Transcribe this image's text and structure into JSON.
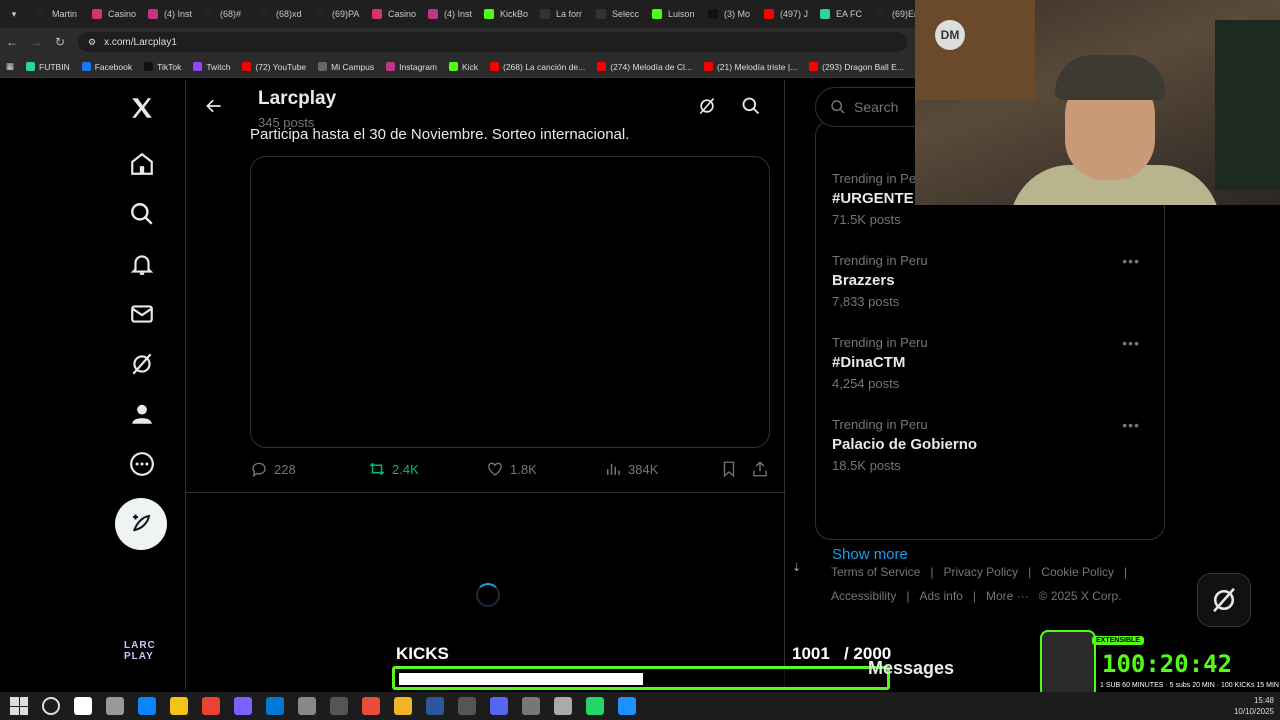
{
  "browser": {
    "tabs": [
      {
        "label": "Martin",
        "color": "#222"
      },
      {
        "label": "Casino",
        "color": "#d6336c"
      },
      {
        "label": "(4) Inst",
        "color": "#c13584"
      },
      {
        "label": "(68)#",
        "color": "#222"
      },
      {
        "label": "(68)xd",
        "color": "#222"
      },
      {
        "label": "(69)PA",
        "color": "#222"
      },
      {
        "label": "Casino",
        "color": "#d6336c"
      },
      {
        "label": "(4) Inst",
        "color": "#c13584"
      },
      {
        "label": "KickBo",
        "color": "#53fc18"
      },
      {
        "label": "La forr",
        "color": "#333"
      },
      {
        "label": "Selecc",
        "color": "#333"
      },
      {
        "label": "Luison",
        "color": "#53fc18"
      },
      {
        "label": "(3) Mo",
        "color": "#111"
      },
      {
        "label": "(497) J",
        "color": "#ff0000"
      },
      {
        "label": "EA FC",
        "color": "#2bd4a0"
      },
      {
        "label": "(69)Enc",
        "color": "#222"
      }
    ],
    "url": "x.com/Larcplay1",
    "bookmarks": [
      {
        "label": "FUTBIN",
        "color": "#2bd4a0"
      },
      {
        "label": "Facebook",
        "color": "#1877f2"
      },
      {
        "label": "TikTok",
        "color": "#111"
      },
      {
        "label": "Twitch",
        "color": "#9146ff"
      },
      {
        "label": "(72) YouTube",
        "color": "#ff0000"
      },
      {
        "label": "Mi Campus",
        "color": "#666"
      },
      {
        "label": "Instagram",
        "color": "#c13584"
      },
      {
        "label": "Kick",
        "color": "#53fc18"
      },
      {
        "label": "(268) La canción de...",
        "color": "#ff0000"
      },
      {
        "label": "(274) Melodía de Cl...",
        "color": "#ff0000"
      },
      {
        "label": "(21) Melodía triste |...",
        "color": "#ff0000"
      },
      {
        "label": "(293) Dragon Ball E...",
        "color": "#ff0000"
      }
    ]
  },
  "profile": {
    "name": "Larcplay",
    "posts": "345 posts"
  },
  "post": {
    "text": "Participa hasta el 30 de Noviembre. Sorteo internacional.",
    "replies": "228",
    "reposts": "2.4K",
    "likes": "1.8K",
    "views": "384K"
  },
  "sidebar": {
    "search_placeholder": "Search",
    "trends": [
      {
        "context": "Trending in Pe",
        "topic": "#URGENTE",
        "count": "71.5K posts"
      },
      {
        "context": "Trending in Peru",
        "topic": "Brazzers",
        "count": "7,833 posts"
      },
      {
        "context": "Trending in Peru",
        "topic": "#DinaCTM",
        "count": "4,254 posts"
      },
      {
        "context": "Trending in Peru",
        "topic": "Palacio de Gobierno",
        "count": "18.5K posts"
      }
    ],
    "more_glyph": "•••",
    "show_more": "Show more",
    "footer": [
      "Terms of Service",
      "|",
      "Privacy Policy",
      "|",
      "Cookie Policy",
      "|",
      "Accessibility",
      "|",
      "Ads info",
      "|",
      "More ···",
      "© 2025 X Corp."
    ]
  },
  "left_nav": {
    "logo_text": "LARC PLAY"
  },
  "overlay": {
    "kicks_label": "KICKS",
    "kicks_count": "1001   / 2000",
    "kicks_progress": 0.5005,
    "messages": "Messages",
    "timer_tag": "EXTENSIBLE",
    "timer_value": "100:20:42",
    "timer_sub": "1 SUB 60 MINUTES · 5 subs 20 MIN · 100 KICKs 15 MIN",
    "webcam_badge": "DM"
  },
  "taskbar": {
    "time": "15:48",
    "date": "10/10/2025",
    "icons": [
      "#1e90ff",
      "#ffffff",
      "#999",
      "#0a84ff",
      "#f0c419",
      "#ea4335",
      "#7b61ff",
      "#0078d4",
      "#888",
      "#555",
      "#e74c3c",
      "#f0b429",
      "#2b579a",
      "#555",
      "#5865f2",
      "#777",
      "#aaa",
      "#25d366",
      "#1e90ff"
    ],
    "accent": "#53fc18"
  },
  "colors": {
    "accent_blue": "#1d9bf0",
    "repost_green": "#00ba7c",
    "kick_green": "#53fc18"
  }
}
